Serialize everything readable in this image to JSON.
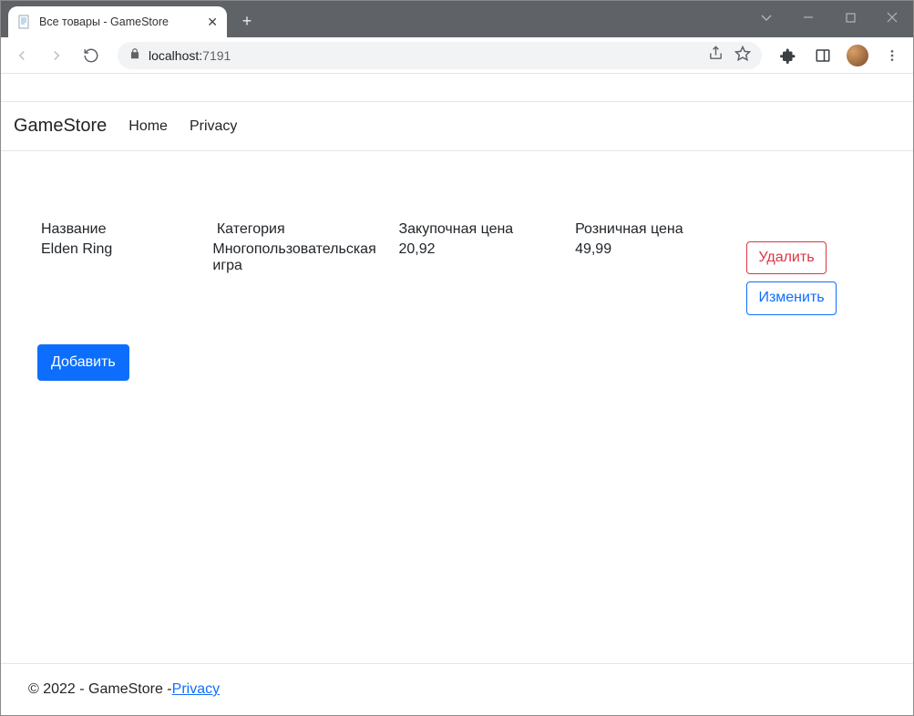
{
  "browser": {
    "tab_title": "Все товары - GameStore",
    "new_tab_glyph": "+",
    "address": {
      "host": "localhost:",
      "port": "7191"
    }
  },
  "navbar": {
    "brand": "GameStore",
    "links": {
      "home": "Home",
      "privacy": "Privacy"
    }
  },
  "table": {
    "headers": {
      "name": "Название",
      "category": "Категория",
      "purchase_price": "Закупочная цена",
      "retail_price": "Розничная цена"
    },
    "rows": [
      {
        "name": "Elden Ring",
        "category": "Многопользовательская игра",
        "purchase_price": "20,92",
        "retail_price": "49,99"
      }
    ],
    "actions": {
      "delete": "Удалить",
      "edit": "Изменить"
    }
  },
  "buttons": {
    "add": "Добавить"
  },
  "footer": {
    "text_prefix": "© 2022 - GameStore - ",
    "privacy_link": "Privacy"
  }
}
